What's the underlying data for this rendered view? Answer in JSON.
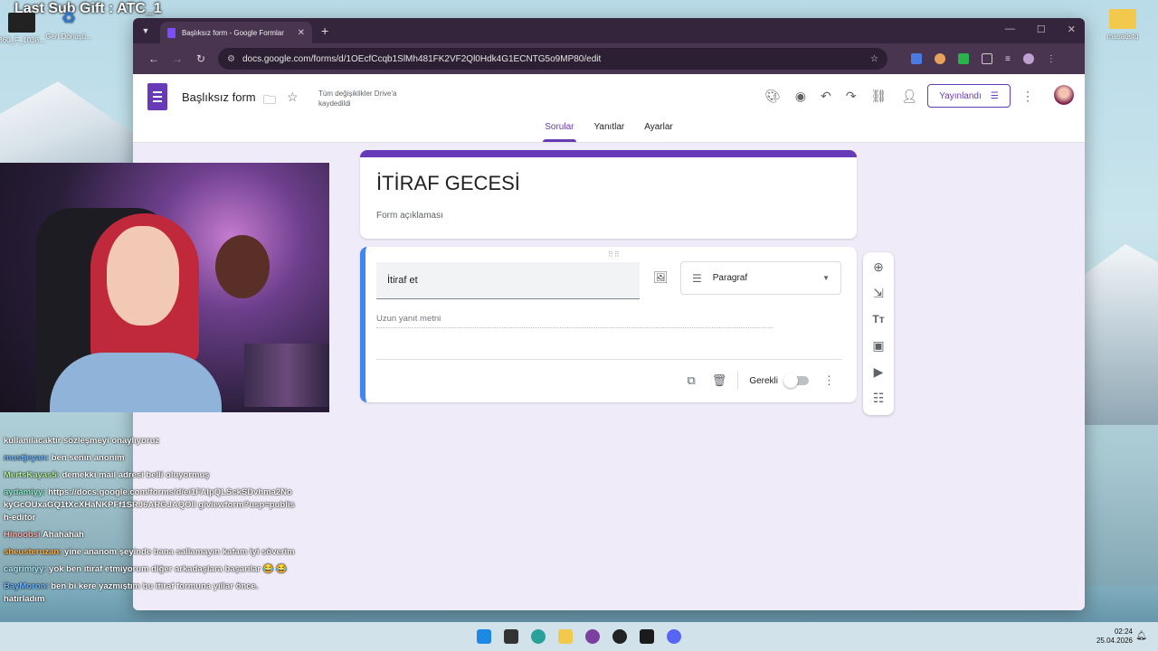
{
  "overlay": {
    "title": "Last Sub Gift : ATC_1"
  },
  "desktop_icons": [
    {
      "label": "360_F_1038..."
    },
    {
      "label": "Geri Dönüşü..."
    },
    {
      "label": "masaüstü"
    }
  ],
  "browser": {
    "tab_title": "Başlıksız form - Google Formlar",
    "url": "docs.google.com/forms/d/1OEcfCcqb1SlMh481FK2VF2Ql0Hdk4G1ECNTG5o9MP80/edit"
  },
  "forms": {
    "doc_title": "Başlıksız form",
    "saved_status": "Tüm değişiklikler Drive'a kaydedildi",
    "publish_label": "Yayınlandı",
    "tabs": [
      "Sorular",
      "Yanıtlar",
      "Ayarlar"
    ],
    "form_title": "İTİRAF GECESİ",
    "form_description": "Form açıklaması",
    "question": {
      "title": "İtiraf et",
      "type": "Paragraf",
      "answer_placeholder": "Uzun yanıt metni",
      "required_label": "Gerekli",
      "required": false
    }
  },
  "chat": [
    {
      "user": "",
      "text": "kullanılacaktır sözleşmeyi onaylıyoruz"
    },
    {
      "user": "mustjeyan:",
      "text": "ben senin anonim"
    },
    {
      "user": "MertsKayas5:",
      "text": "demekki mail adresi belli oluyormuş"
    },
    {
      "user": "aydamiyy:",
      "text": "https://docs.google.com/forms/d/e/1FAIpQLSckSDvhma2NokyGcOUxaGQ1tXcXHaNKPFf1SRJ6ARGJAQOIl g/viewform?usp=publish-editor"
    },
    {
      "user": "Hinoobsi",
      "text": "Ahahahah"
    },
    {
      "user": "sheusteruzan:",
      "text": "yine ananom şeyinde bana sallamayın kafam iyi söverim"
    },
    {
      "user": "cagrimiyy:",
      "text": "yok ben itiraf etmiyorum diğer arkadaşlara başarılar 😂 😂"
    },
    {
      "user": "BayMoron:",
      "text": "ben bi kere yazmıştım bu itiraf formuna yıllar önce. hatırladım"
    }
  ],
  "taskbar": {
    "time": "02:24",
    "date": "25.04.2026"
  },
  "colors": {
    "accent": "#673ab7",
    "question_accent": "#4285f4",
    "form_bg": "#f0ebf8"
  }
}
